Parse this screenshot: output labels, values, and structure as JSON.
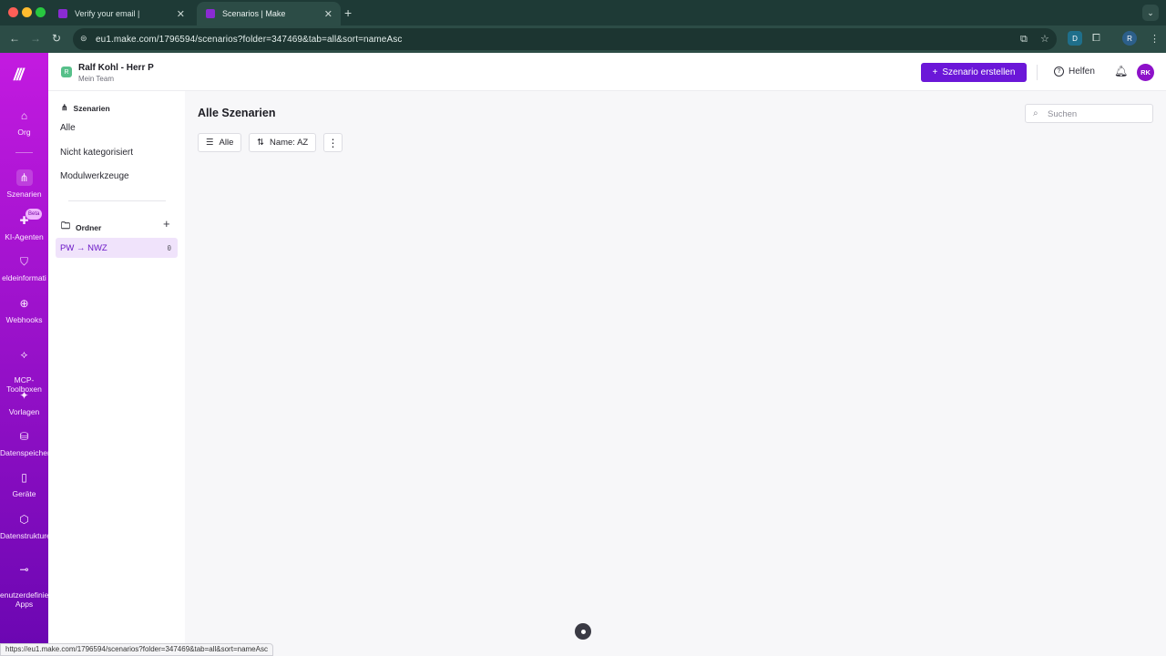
{
  "browser": {
    "tabs": [
      {
        "title": "Verify your email |",
        "active": false
      },
      {
        "title": "Scenarios | Make",
        "active": true
      }
    ],
    "url": "eu1.make.com/1796594/scenarios?folder=347469&tab=all&sort=nameAsc",
    "status_url": "https://eu1.make.com/1796594/scenarios?folder=347469&tab=all&sort=nameAsc",
    "profile_initial": "R",
    "ext_initial": "D"
  },
  "leftnav": {
    "items": [
      {
        "label": "Org",
        "icon": "home-icon"
      },
      {
        "label": "Szenarien",
        "icon": "scenarios-icon",
        "active": true
      },
      {
        "label": "KI-Agenten",
        "icon": "ai-agent-icon",
        "badge": "Beta"
      },
      {
        "label": "eldeinformati",
        "icon": "shield-icon"
      },
      {
        "label": "Webhooks",
        "icon": "globe-icon"
      },
      {
        "label": "MCP-\nToolboxen",
        "icon": "mcp-icon"
      },
      {
        "label": "Vorlagen",
        "icon": "puzzle-icon"
      },
      {
        "label": "Datenspeicher",
        "icon": "database-icon"
      },
      {
        "label": "Geräte",
        "icon": "phone-icon"
      },
      {
        "label": "Datenstrukturen",
        "icon": "cube-icon"
      },
      {
        "label": "enutzerdefinier\nApps",
        "icon": "custom-apps-icon"
      }
    ]
  },
  "topbar": {
    "team_badge": "R",
    "team_name": "Ralf Kohl - Herr P",
    "team_sub": "Mein Team",
    "create_label": "Szenario erstellen",
    "help_label": "Helfen",
    "avatar": "RK"
  },
  "panel": {
    "header": "Szenarien",
    "links": [
      "Alle",
      "Nicht kategorisiert",
      "Modulwerkzeuge"
    ],
    "folder_header": "Ordner",
    "folders": [
      {
        "name": "PW → NWZ",
        "count": "0"
      }
    ]
  },
  "main": {
    "title": "Alle Szenarien",
    "search_placeholder": "Suchen",
    "filter_label": "Alle",
    "sort_label": "Name: AZ"
  },
  "colors": {
    "accent": "#6b17d8",
    "nav_top": "#c31ae0",
    "nav_bottom": "#6a06b1"
  }
}
